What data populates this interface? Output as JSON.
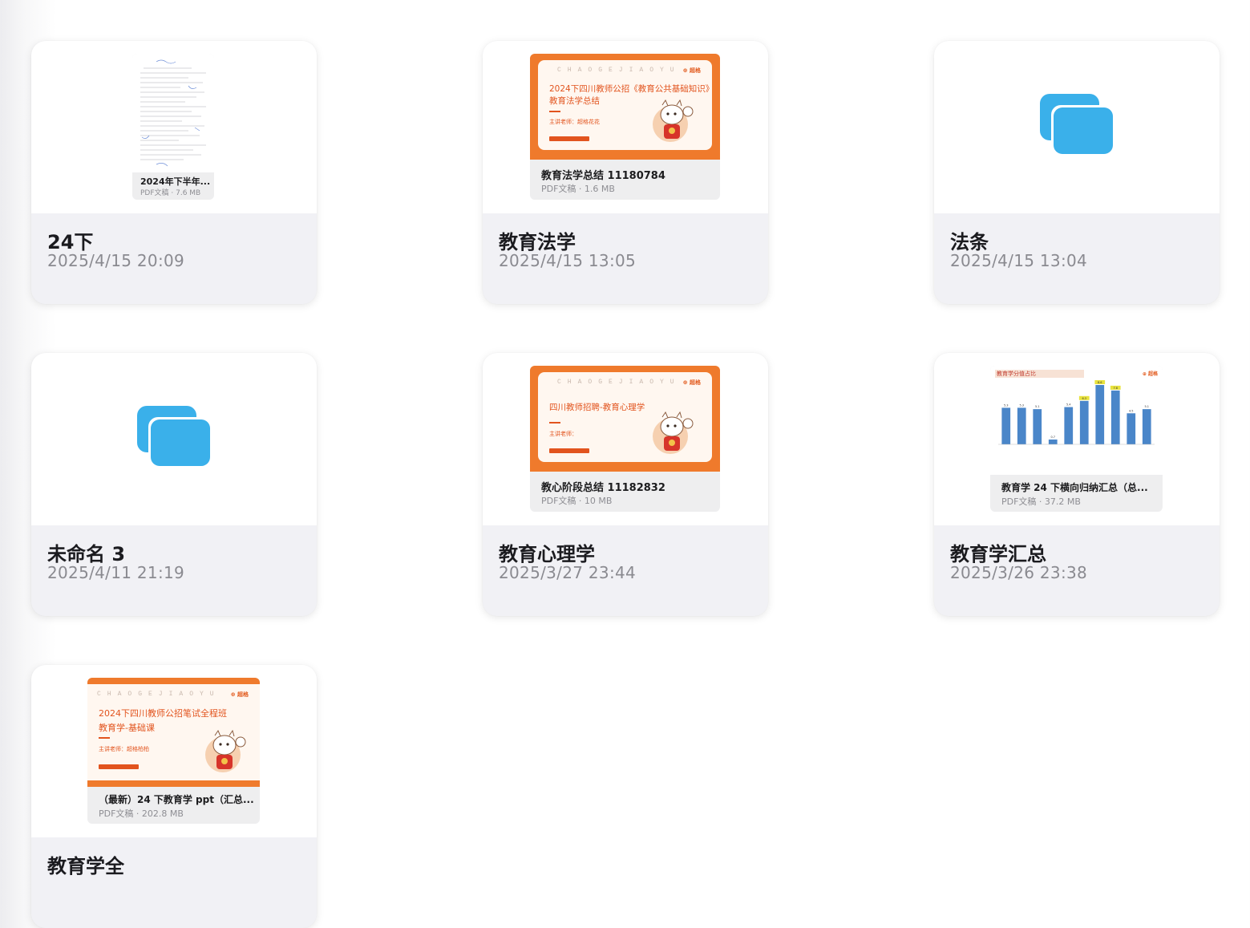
{
  "folders": [
    {
      "title": "24下",
      "date": "2025/4/15 20:09",
      "preview": {
        "kind": "document",
        "name": "2024年下半年...",
        "meta": "PDF文稿 · 7.6 MB"
      }
    },
    {
      "title": "教育法学",
      "date": "2025/4/15 13:05",
      "preview": {
        "kind": "slide",
        "name": "教育法学总结 11180784",
        "meta": "PDF文稿 · 1.6 MB",
        "slide_brand": "⊕ 超格",
        "slide_heading1": "2024下四川教师公招《教育公共基础知识》",
        "slide_heading2": "教育法学总结",
        "slide_teacher": "主讲老师：超格花花"
      }
    },
    {
      "title": "法条",
      "date": "2025/4/15 13:04",
      "preview": {
        "kind": "folder-icon",
        "icon": "stacked-documents-icon"
      }
    },
    {
      "title": "未命名 3",
      "date": "2025/4/11 21:19",
      "preview": {
        "kind": "folder-icon",
        "icon": "stacked-documents-icon"
      }
    },
    {
      "title": "教育心理学",
      "date": "2025/3/27 23:44",
      "preview": {
        "kind": "slide",
        "name": "教心阶段总结 11182832",
        "meta": "PDF文稿 · 10 MB",
        "slide_brand": "⊕ 超格",
        "slide_heading1": "四川教师招聘-教育心理学",
        "slide_heading2": "",
        "slide_teacher": "主讲老师："
      }
    },
    {
      "title": "教育学汇总",
      "date": "2025/3/26 23:38",
      "preview": {
        "kind": "chart",
        "name": "教育学 24 下横向归纳汇总（总...",
        "meta": "PDF文稿 · 37.2 MB",
        "chart_title": "教育学分值占比",
        "chart_brand": "⊕ 超格"
      }
    },
    {
      "title": "教育学全",
      "date": "",
      "preview": {
        "kind": "slide",
        "name": "（最新）24 下教育学 ppt（汇总...",
        "meta": "PDF文稿 · 202.8 MB",
        "slide_brand": "⊕ 超格",
        "slide_heading1": "2024下四川教师公招笔试全程班",
        "slide_heading2": "教育学-基础课",
        "slide_teacher": "主讲老师：超格柏柏"
      }
    }
  ],
  "colors": {
    "accent_blue": "#3ab0ea",
    "slide_orange": "#ef7a2c",
    "chart_bar": "#4a86c9",
    "chart_highlight": "#e8e23c"
  },
  "chart_data": {
    "type": "bar",
    "title": "教育学分值占比",
    "values": [
      5.3,
      5.3,
      5.1,
      0.7,
      5.4,
      6.3,
      8.6,
      7.8,
      4.5,
      5.1
    ],
    "highlight_indices": [
      5,
      6,
      7
    ],
    "grid": false
  }
}
